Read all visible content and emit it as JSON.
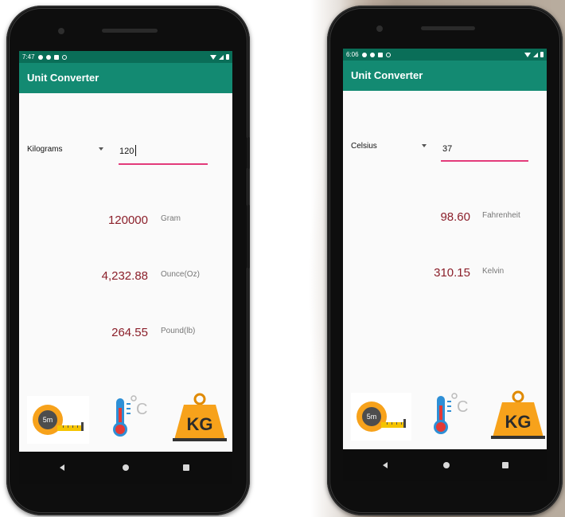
{
  "phones": [
    {
      "status_time": "7:47",
      "app_title": "Unit Converter",
      "unit_spinner": "Kilograms",
      "input_value": "120",
      "results": [
        {
          "value": "120000",
          "unit": "Gram"
        },
        {
          "value": "4,232.88",
          "unit": "Ounce(Oz)"
        },
        {
          "value": "264.55",
          "unit": "Pound(lb)"
        }
      ],
      "categories": {
        "length_icon": "tape-measure-icon",
        "length_text": "5m",
        "temperature_icon": "thermometer-icon",
        "temperature_text": "C",
        "weight_icon": "weight-icon",
        "weight_text": "KG"
      }
    },
    {
      "status_time": "6:06",
      "app_title": "Unit Converter",
      "unit_spinner": "Celsius",
      "input_value": "37",
      "results": [
        {
          "value": "98.60",
          "unit": "Fahrenheit"
        },
        {
          "value": "310.15",
          "unit": "Kelvin"
        }
      ],
      "categories": {
        "length_icon": "tape-measure-icon",
        "length_text": "5m",
        "temperature_icon": "thermometer-icon",
        "temperature_text": "C",
        "weight_icon": "weight-icon",
        "weight_text": "KG"
      }
    }
  ],
  "colors": {
    "app_bar": "#138a72",
    "status_bar": "#0a6e58",
    "underline_accent": "#e33b7a",
    "result_value": "#8b1f2a"
  }
}
